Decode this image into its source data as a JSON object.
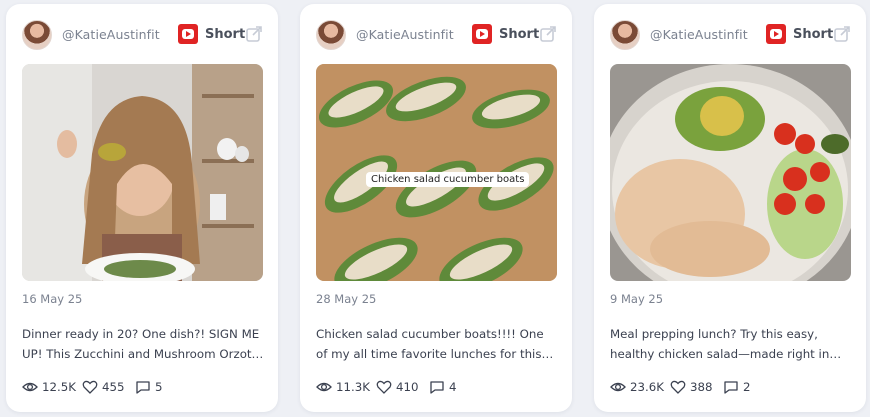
{
  "cards": [
    {
      "handle": "@KatieAustinfit",
      "platform_label": "Short",
      "date": "16 May 25",
      "description": "Dinner ready in 20? One dish?! SIGN ME UP! This Zucchini and Mushroom Orzotto is the perfect",
      "views": "12.5K",
      "likes": "455",
      "comments": "5"
    },
    {
      "handle": "@KatieAustinfit",
      "platform_label": "Short",
      "caption_overlay": "Chicken salad cucumber boats",
      "date": "28 May 25",
      "description": "Chicken salad cucumber boats!!!! One of my all time favorite lunches for this time of year",
      "views": "11.3K",
      "likes": "410",
      "comments": "4"
    },
    {
      "handle": "@KatieAustinfit",
      "platform_label": "Short",
      "date": "9 May 25",
      "description": "Meal prepping lunch? Try this easy, healthy chicken salad—made right in the bowl",
      "views": "23.6K",
      "likes": "388",
      "comments": "2"
    }
  ],
  "colors": {
    "youtube_red": "#e02424",
    "muted_text": "#7b8290",
    "body_text": "#3b4150"
  },
  "icons": {
    "platform": "youtube-icon",
    "external": "external-link-icon",
    "views": "eye-icon",
    "likes": "heart-icon",
    "comments": "comment-icon"
  }
}
